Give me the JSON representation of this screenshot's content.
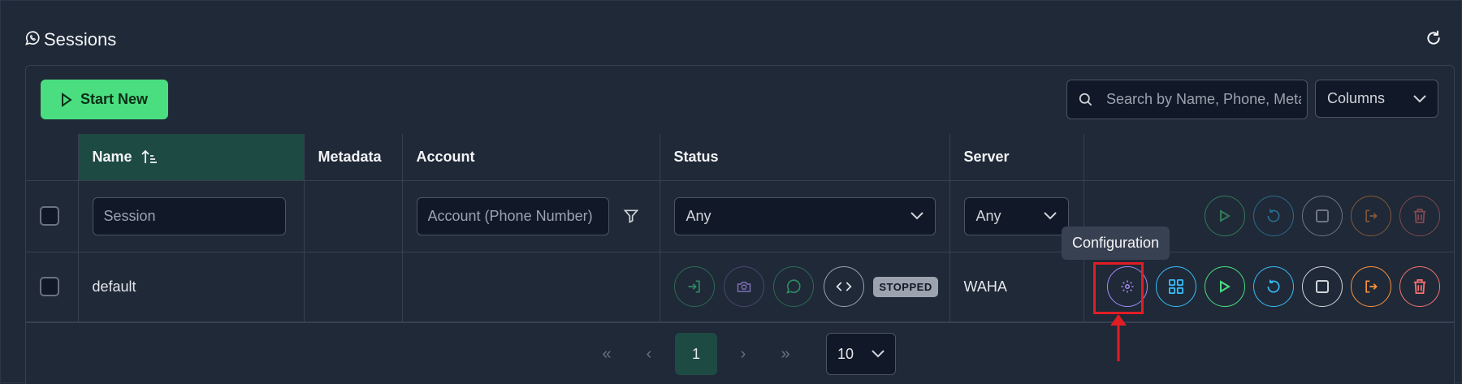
{
  "header": {
    "title": "Sessions"
  },
  "toolbar": {
    "start_label": "Start New",
    "search_placeholder": "Search by Name, Phone, Metadata",
    "columns_label": "Columns"
  },
  "table": {
    "headers": {
      "name": "Name",
      "metadata": "Metadata",
      "account": "Account",
      "status": "Status",
      "server": "Server"
    },
    "filters": {
      "session_placeholder": "Session",
      "account_placeholder": "Account (Phone Number)",
      "status_value": "Any",
      "server_value": "Any"
    },
    "rows": [
      {
        "name": "default",
        "metadata": "",
        "account": "",
        "status": "STOPPED",
        "server": "WAHA"
      }
    ]
  },
  "tooltip": {
    "text": "Configuration"
  },
  "pagination": {
    "first": "«",
    "prev": "‹",
    "current": "1",
    "next": "›",
    "last": "»",
    "per_page": "10"
  },
  "colors": {
    "accent_green": "#4ade80",
    "purple": "#a78bfa",
    "blue": "#38bdf8",
    "orange": "#fb923c",
    "red": "#f87171",
    "highlight": "#e11d24"
  }
}
